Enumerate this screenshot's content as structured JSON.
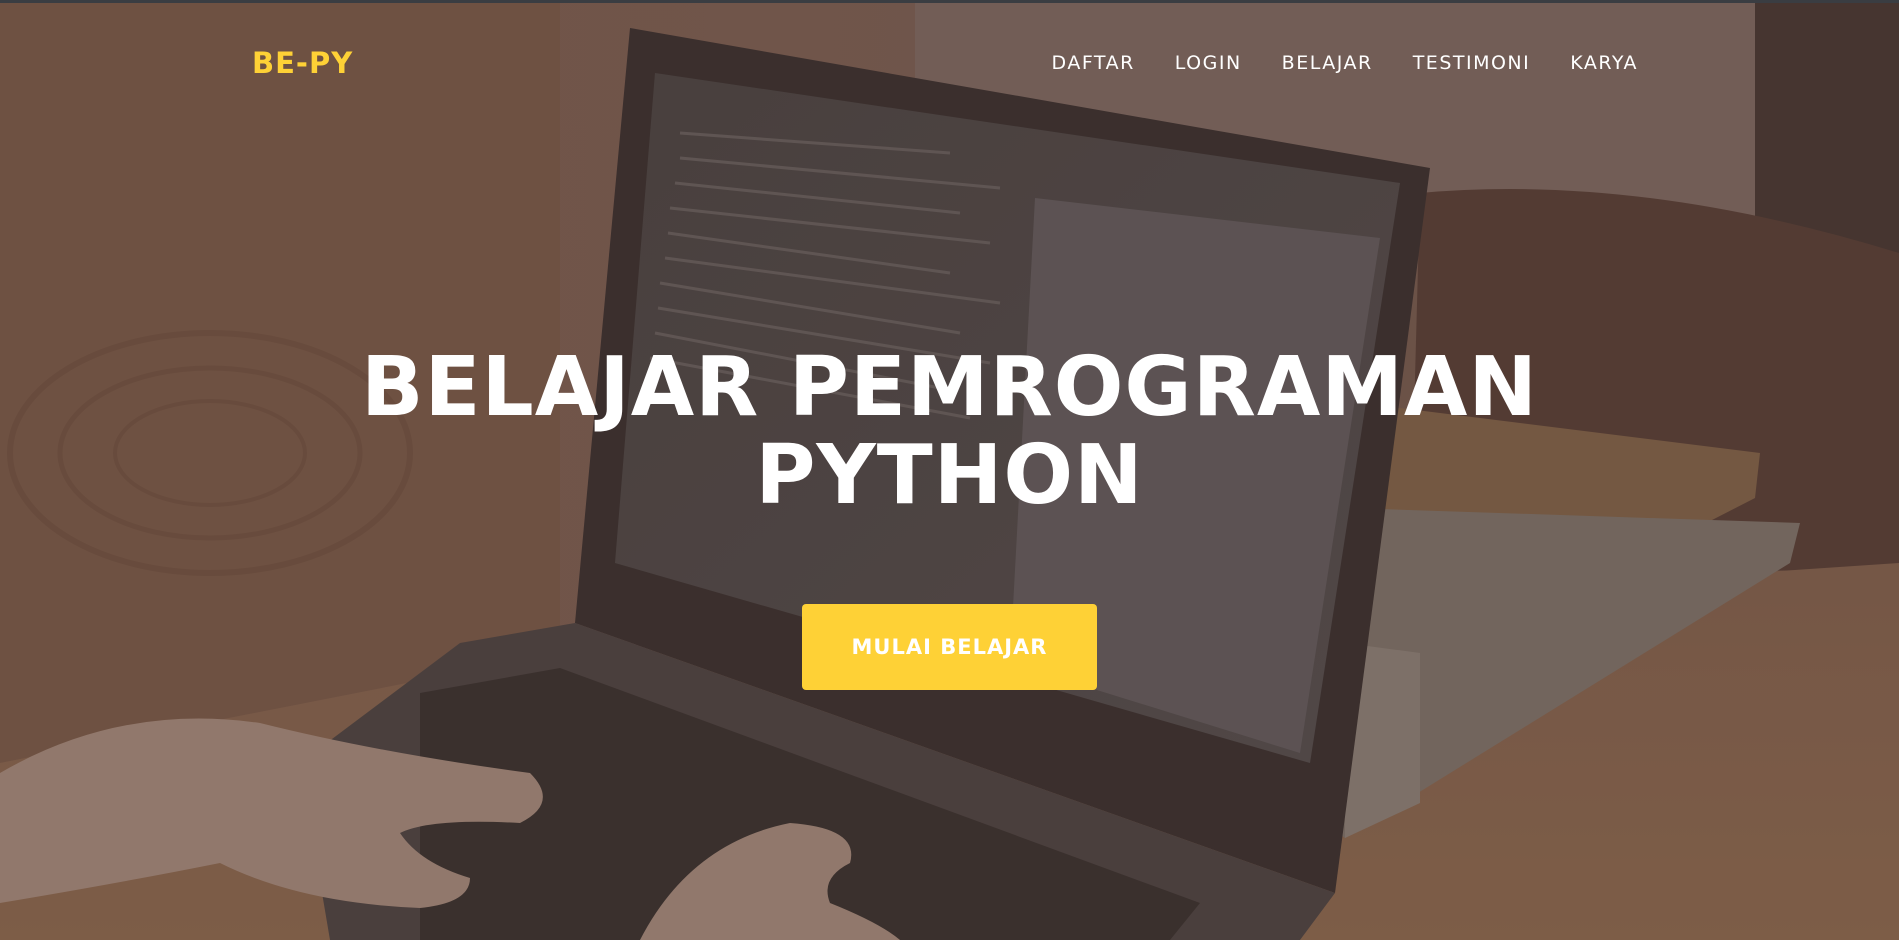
{
  "brand": {
    "name": "BE-PY"
  },
  "nav": {
    "items": [
      {
        "label": "DAFTAR"
      },
      {
        "label": "LOGIN"
      },
      {
        "label": "BELAJAR"
      },
      {
        "label": "TESTIMONI"
      },
      {
        "label": "KARYA"
      }
    ]
  },
  "hero": {
    "heading_line1": "BELAJAR PEMROGRAMAN",
    "heading_line2": "PYTHON",
    "cta_label": "MULAI BELAJAR",
    "background_image": "photo of hands typing on a laptop on a wooden desk with books"
  },
  "colors": {
    "accent": "#fed136",
    "text_light": "#ffffff"
  }
}
